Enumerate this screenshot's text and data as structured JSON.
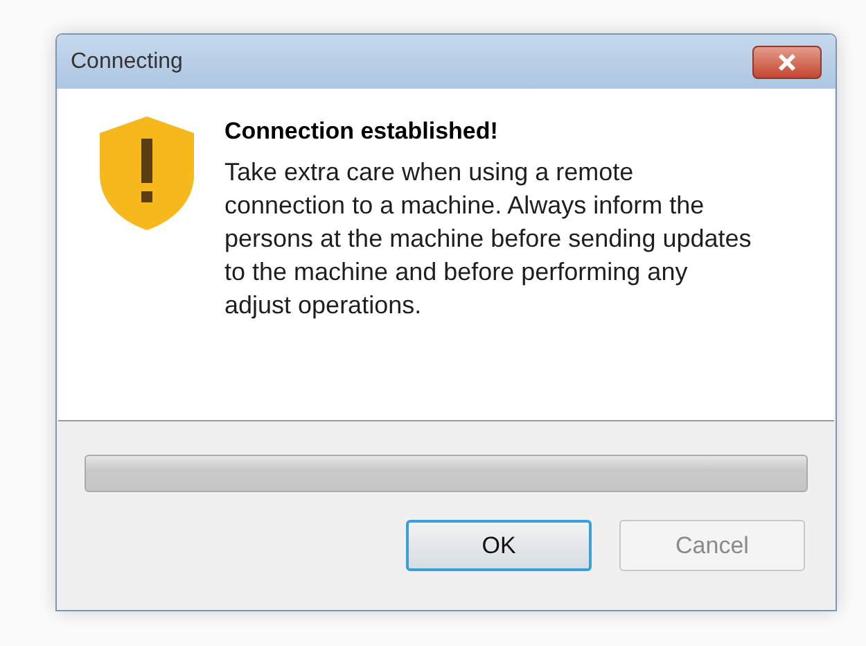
{
  "window": {
    "title": "Connecting"
  },
  "message": {
    "heading": "Connection established!",
    "body": "Take extra care when using a remote connection to a machine. Always inform the persons at the machine before sending updates to the machine and before performing any adjust operations."
  },
  "progress": {
    "level": 0
  },
  "buttons": [
    {
      "label": "OK",
      "default": true,
      "disabled": false
    },
    {
      "label": "Cancel",
      "default": false,
      "disabled": true
    }
  ]
}
